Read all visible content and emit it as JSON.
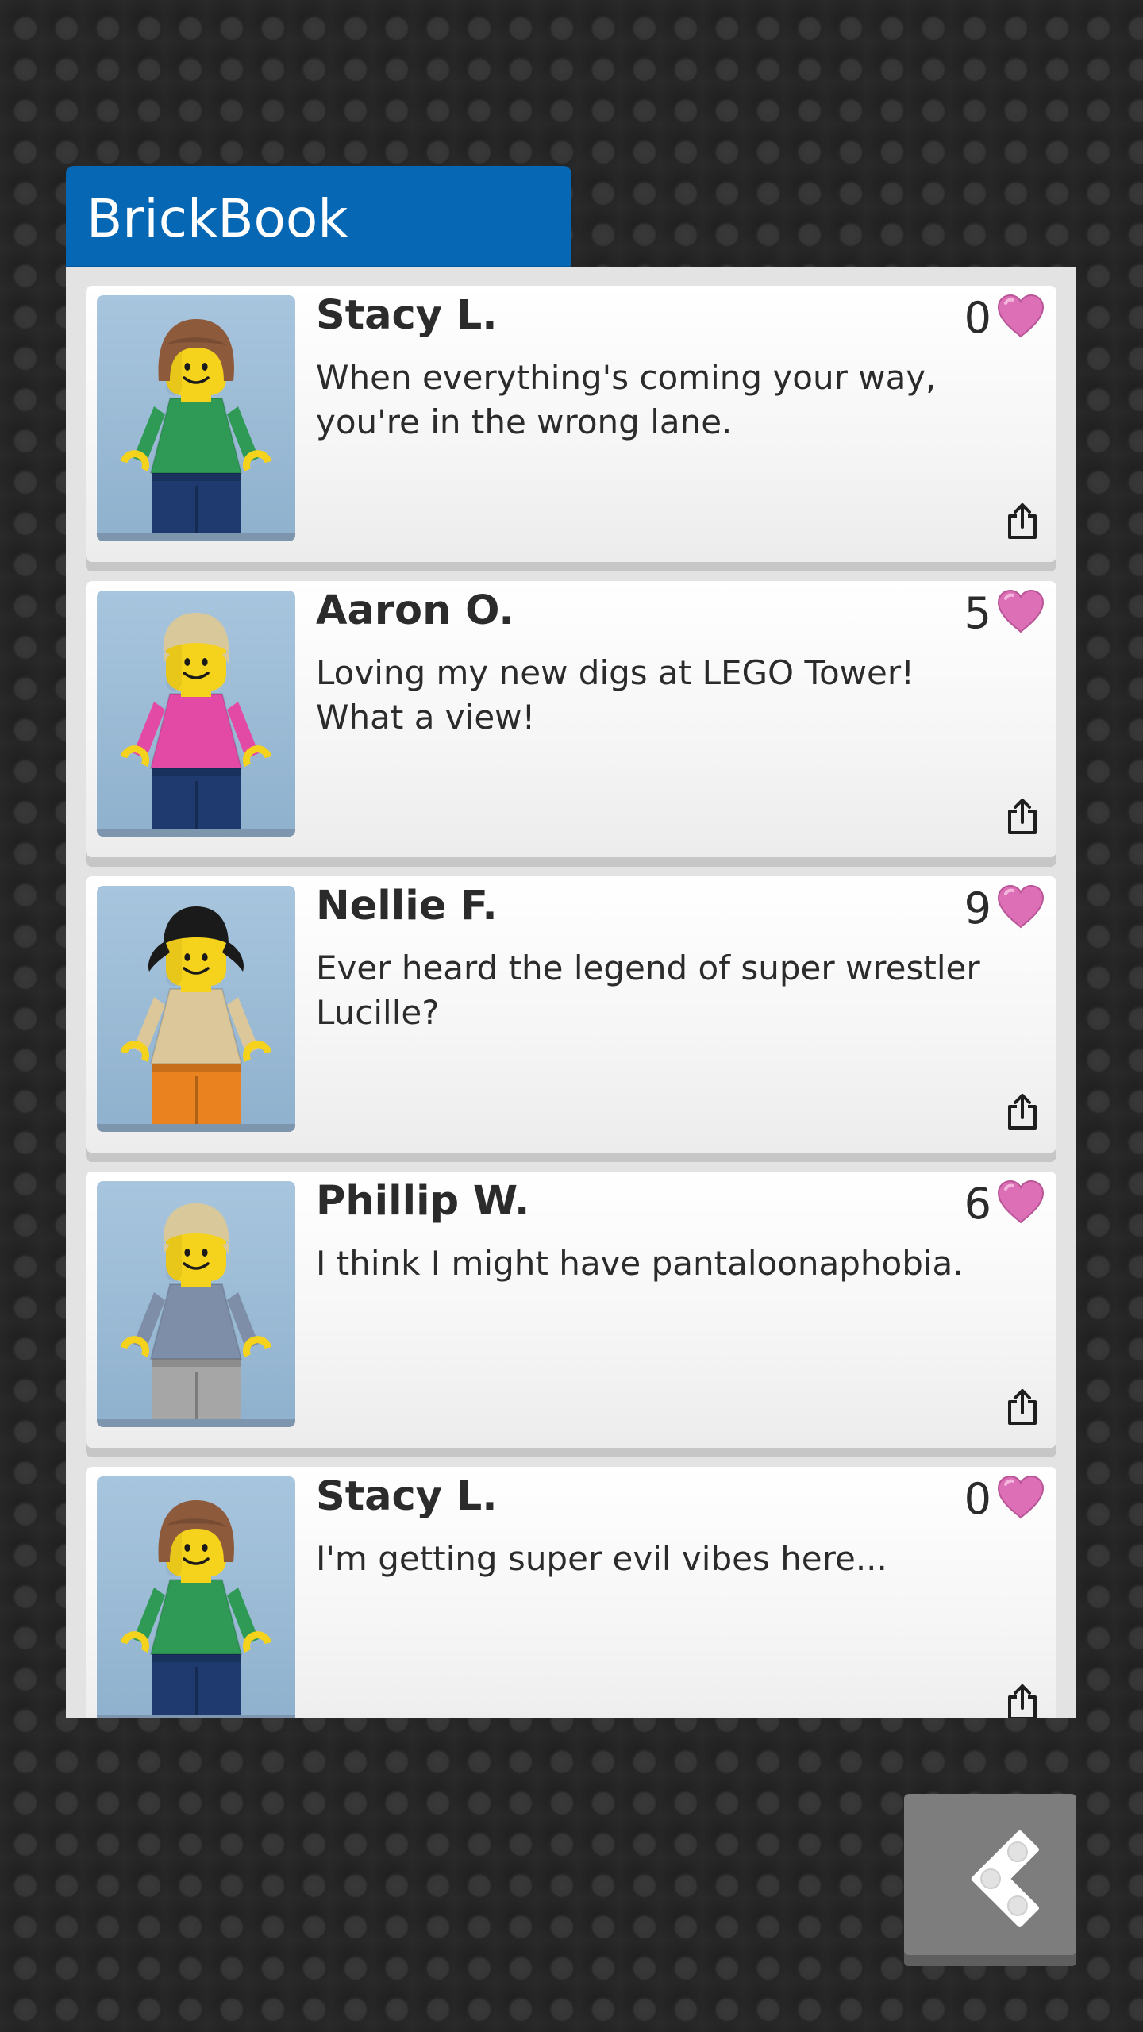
{
  "app": {
    "title": "BrickBook"
  },
  "colors": {
    "header_blue": "#0667b5",
    "heart_pink": "#dc6fb6",
    "card_background": "#f4f4f4",
    "text_dark": "#2b2b2b"
  },
  "icons": {
    "like": "heart-icon",
    "share": "share-icon",
    "back": "lego-brick-back-icon"
  },
  "posts": [
    {
      "author": "Stacy L.",
      "likes": "0",
      "text": "When everything's coming your way, you're in the wrong lane.",
      "avatar": {
        "hair": "#8d5a3b",
        "torso": "#2e9a55",
        "legs": "#1e3a6e",
        "hair_style": "bob"
      }
    },
    {
      "author": "Aaron O.",
      "likes": "5",
      "text": "Loving my new digs at LEGO Tower! What a view!",
      "avatar": {
        "hair": "#d9c99a",
        "torso": "#e34aa6",
        "legs": "#1e3a6e",
        "hair_style": "short"
      }
    },
    {
      "author": "Nellie F.",
      "likes": "9",
      "text": "Ever heard the legend of super wrestler Lucille?",
      "avatar": {
        "hair": "#1a1a1a",
        "torso": "#dcc79a",
        "legs": "#e9821f",
        "hair_style": "pigtails"
      }
    },
    {
      "author": "Phillip W.",
      "likes": "6",
      "text": "I think I might have pantaloonaphobia.",
      "avatar": {
        "hair": "#d9c99a",
        "torso": "#7e8ea8",
        "legs": "#a6a6a6",
        "hair_style": "short"
      }
    },
    {
      "author": "Stacy L.",
      "likes": "0",
      "text": "I'm getting super evil vibes here...",
      "avatar": {
        "hair": "#8d5a3b",
        "torso": "#2e9a55",
        "legs": "#1e3a6e",
        "hair_style": "bob"
      }
    }
  ]
}
